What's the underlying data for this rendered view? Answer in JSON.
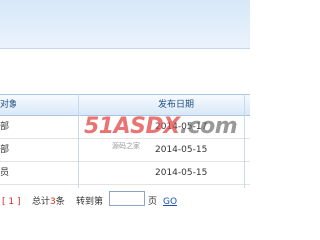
{
  "table": {
    "columns": [
      "对象",
      "发布日期"
    ],
    "rows": [
      {
        "c1": "部",
        "date": "2014-05-17"
      },
      {
        "c1": "部",
        "date": "2014-05-15"
      },
      {
        "c1": "员",
        "date": "2014-05-15"
      }
    ]
  },
  "pager": {
    "current_page": "[ 1 ]",
    "total_prefix": "总计",
    "total_count": "3",
    "total_suffix": "条",
    "goto_label": "转到第",
    "page_input_value": "",
    "page_suffix": "页",
    "go_label": "GO"
  },
  "watermark": {
    "brand_digits": "51",
    "brand_text": "ASDX",
    "brand_tld": ".com",
    "slogan": "源码之家"
  },
  "colors": {
    "accent": "#d52b1e",
    "link": "#1a4fb0",
    "header_text": "#1f4f82"
  }
}
